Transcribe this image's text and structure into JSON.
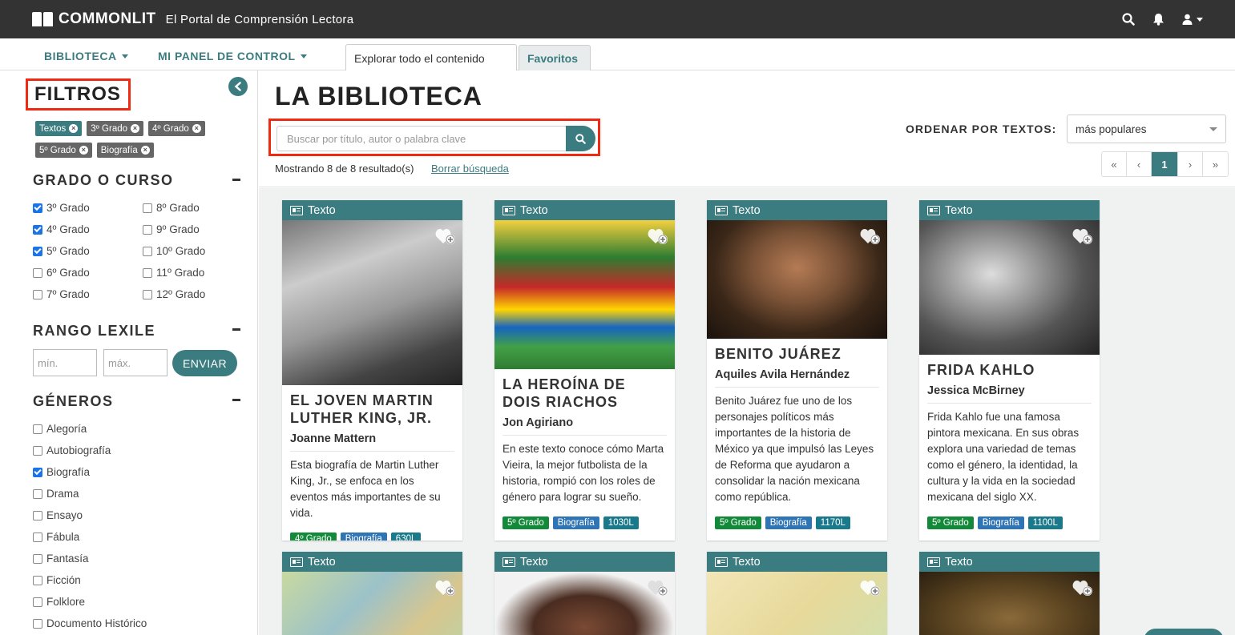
{
  "header": {
    "brand": "COMMONLIT",
    "tagline": "El Portal de Comprensión Lectora",
    "icons": [
      "search-icon",
      "bell-icon",
      "user-icon"
    ]
  },
  "nav": {
    "biblioteca": "BIBLIOTECA",
    "panel": "MI PANEL DE CONTROL",
    "tabs": [
      {
        "label": "Explorar todo el contenido",
        "active": true
      },
      {
        "label": "Favoritos",
        "active": false
      }
    ]
  },
  "sidebar": {
    "title": "FILTROS",
    "chips": [
      "Textos",
      "3º Grado",
      "4º Grado",
      "5º Grado",
      "Biografía"
    ],
    "grade_section": "GRADO O CURSO",
    "grades": [
      {
        "label": "3º Grado",
        "checked": true
      },
      {
        "label": "4º Grado",
        "checked": true
      },
      {
        "label": "5º Grado",
        "checked": true
      },
      {
        "label": "6º Grado",
        "checked": false
      },
      {
        "label": "7º Grado",
        "checked": false
      },
      {
        "label": "8º Grado",
        "checked": false
      },
      {
        "label": "9º Grado",
        "checked": false
      },
      {
        "label": "10º Grado",
        "checked": false
      },
      {
        "label": "11º Grado",
        "checked": false
      },
      {
        "label": "12º Grado",
        "checked": false
      }
    ],
    "lexile_section": "RANGO LEXILE",
    "lexile_min_placeholder": "mín.",
    "lexile_max_placeholder": "máx.",
    "send_label": "ENVIAR",
    "genre_section": "GÉNEROS",
    "genres": [
      {
        "label": "Alegoría",
        "checked": false
      },
      {
        "label": "Autobiografía",
        "checked": false
      },
      {
        "label": "Biografía",
        "checked": true
      },
      {
        "label": "Drama",
        "checked": false
      },
      {
        "label": "Ensayo",
        "checked": false
      },
      {
        "label": "Fábula",
        "checked": false
      },
      {
        "label": "Fantasía",
        "checked": false
      },
      {
        "label": "Ficción",
        "checked": false
      },
      {
        "label": "Folklore",
        "checked": false
      },
      {
        "label": "Documento Histórico",
        "checked": false
      }
    ]
  },
  "main": {
    "title": "LA BIBLIOTECA",
    "search_placeholder": "Buscar por título, autor o palabra clave",
    "results_text": "Mostrando 8 de 8 resultado(s)",
    "clear_link": "Borrar búsqueda",
    "sort_label": "ORDENAR POR TEXTOS:",
    "sort_value": "más populares",
    "pager": {
      "first": "«",
      "prev": "‹",
      "current": "1",
      "next": "›",
      "last": "»"
    }
  },
  "cards": [
    {
      "type": "Texto",
      "title": "EL JOVEN MARTIN LUTHER KING, JR.",
      "author": "Joanne Mattern",
      "description": "Esta biografía de Martin Luther King, Jr., se enfoca en los eventos más importantes de su vida.",
      "grade": "4º Grado",
      "genre": "Biografía",
      "lexile": "630L"
    },
    {
      "type": "Texto",
      "title": "LA HEROÍNA DE DOIS RIACHOS",
      "author": "Jon Agiriano",
      "description": "En este texto conoce cómo Marta Vieira, la mejor futbolista de la historia, rompió con los roles de género para lograr su sueño.",
      "grade": "5º Grado",
      "genre": "Biografía",
      "lexile": "1030L"
    },
    {
      "type": "Texto",
      "title": "BENITO JUÁREZ",
      "author": "Aquiles Avila Hernández",
      "description": "Benito Juárez fue uno de los personajes políticos más importantes de la historia de México ya que impulsó las Leyes de Reforma que ayudaron a consolidar la nación mexicana como república.",
      "grade": "5º Grado",
      "genre": "Biografía",
      "lexile": "1170L"
    },
    {
      "type": "Texto",
      "title": "FRIDA KAHLO",
      "author": "Jessica McBirney",
      "description": "Frida Kahlo fue una famosa pintora mexicana. En sus obras explora una variedad de temas como el género, la identidad, la cultura y la vida en la sociedad mexicana del siglo XX.",
      "grade": "5º Grado",
      "genre": "Biografía",
      "lexile": "1100L"
    },
    {
      "type": "Texto"
    },
    {
      "type": "Texto"
    },
    {
      "type": "Texto"
    },
    {
      "type": "Texto"
    }
  ],
  "colors": {
    "accent": "#3b7c80",
    "highlight": "#f02a10",
    "topbar": "#333333"
  }
}
